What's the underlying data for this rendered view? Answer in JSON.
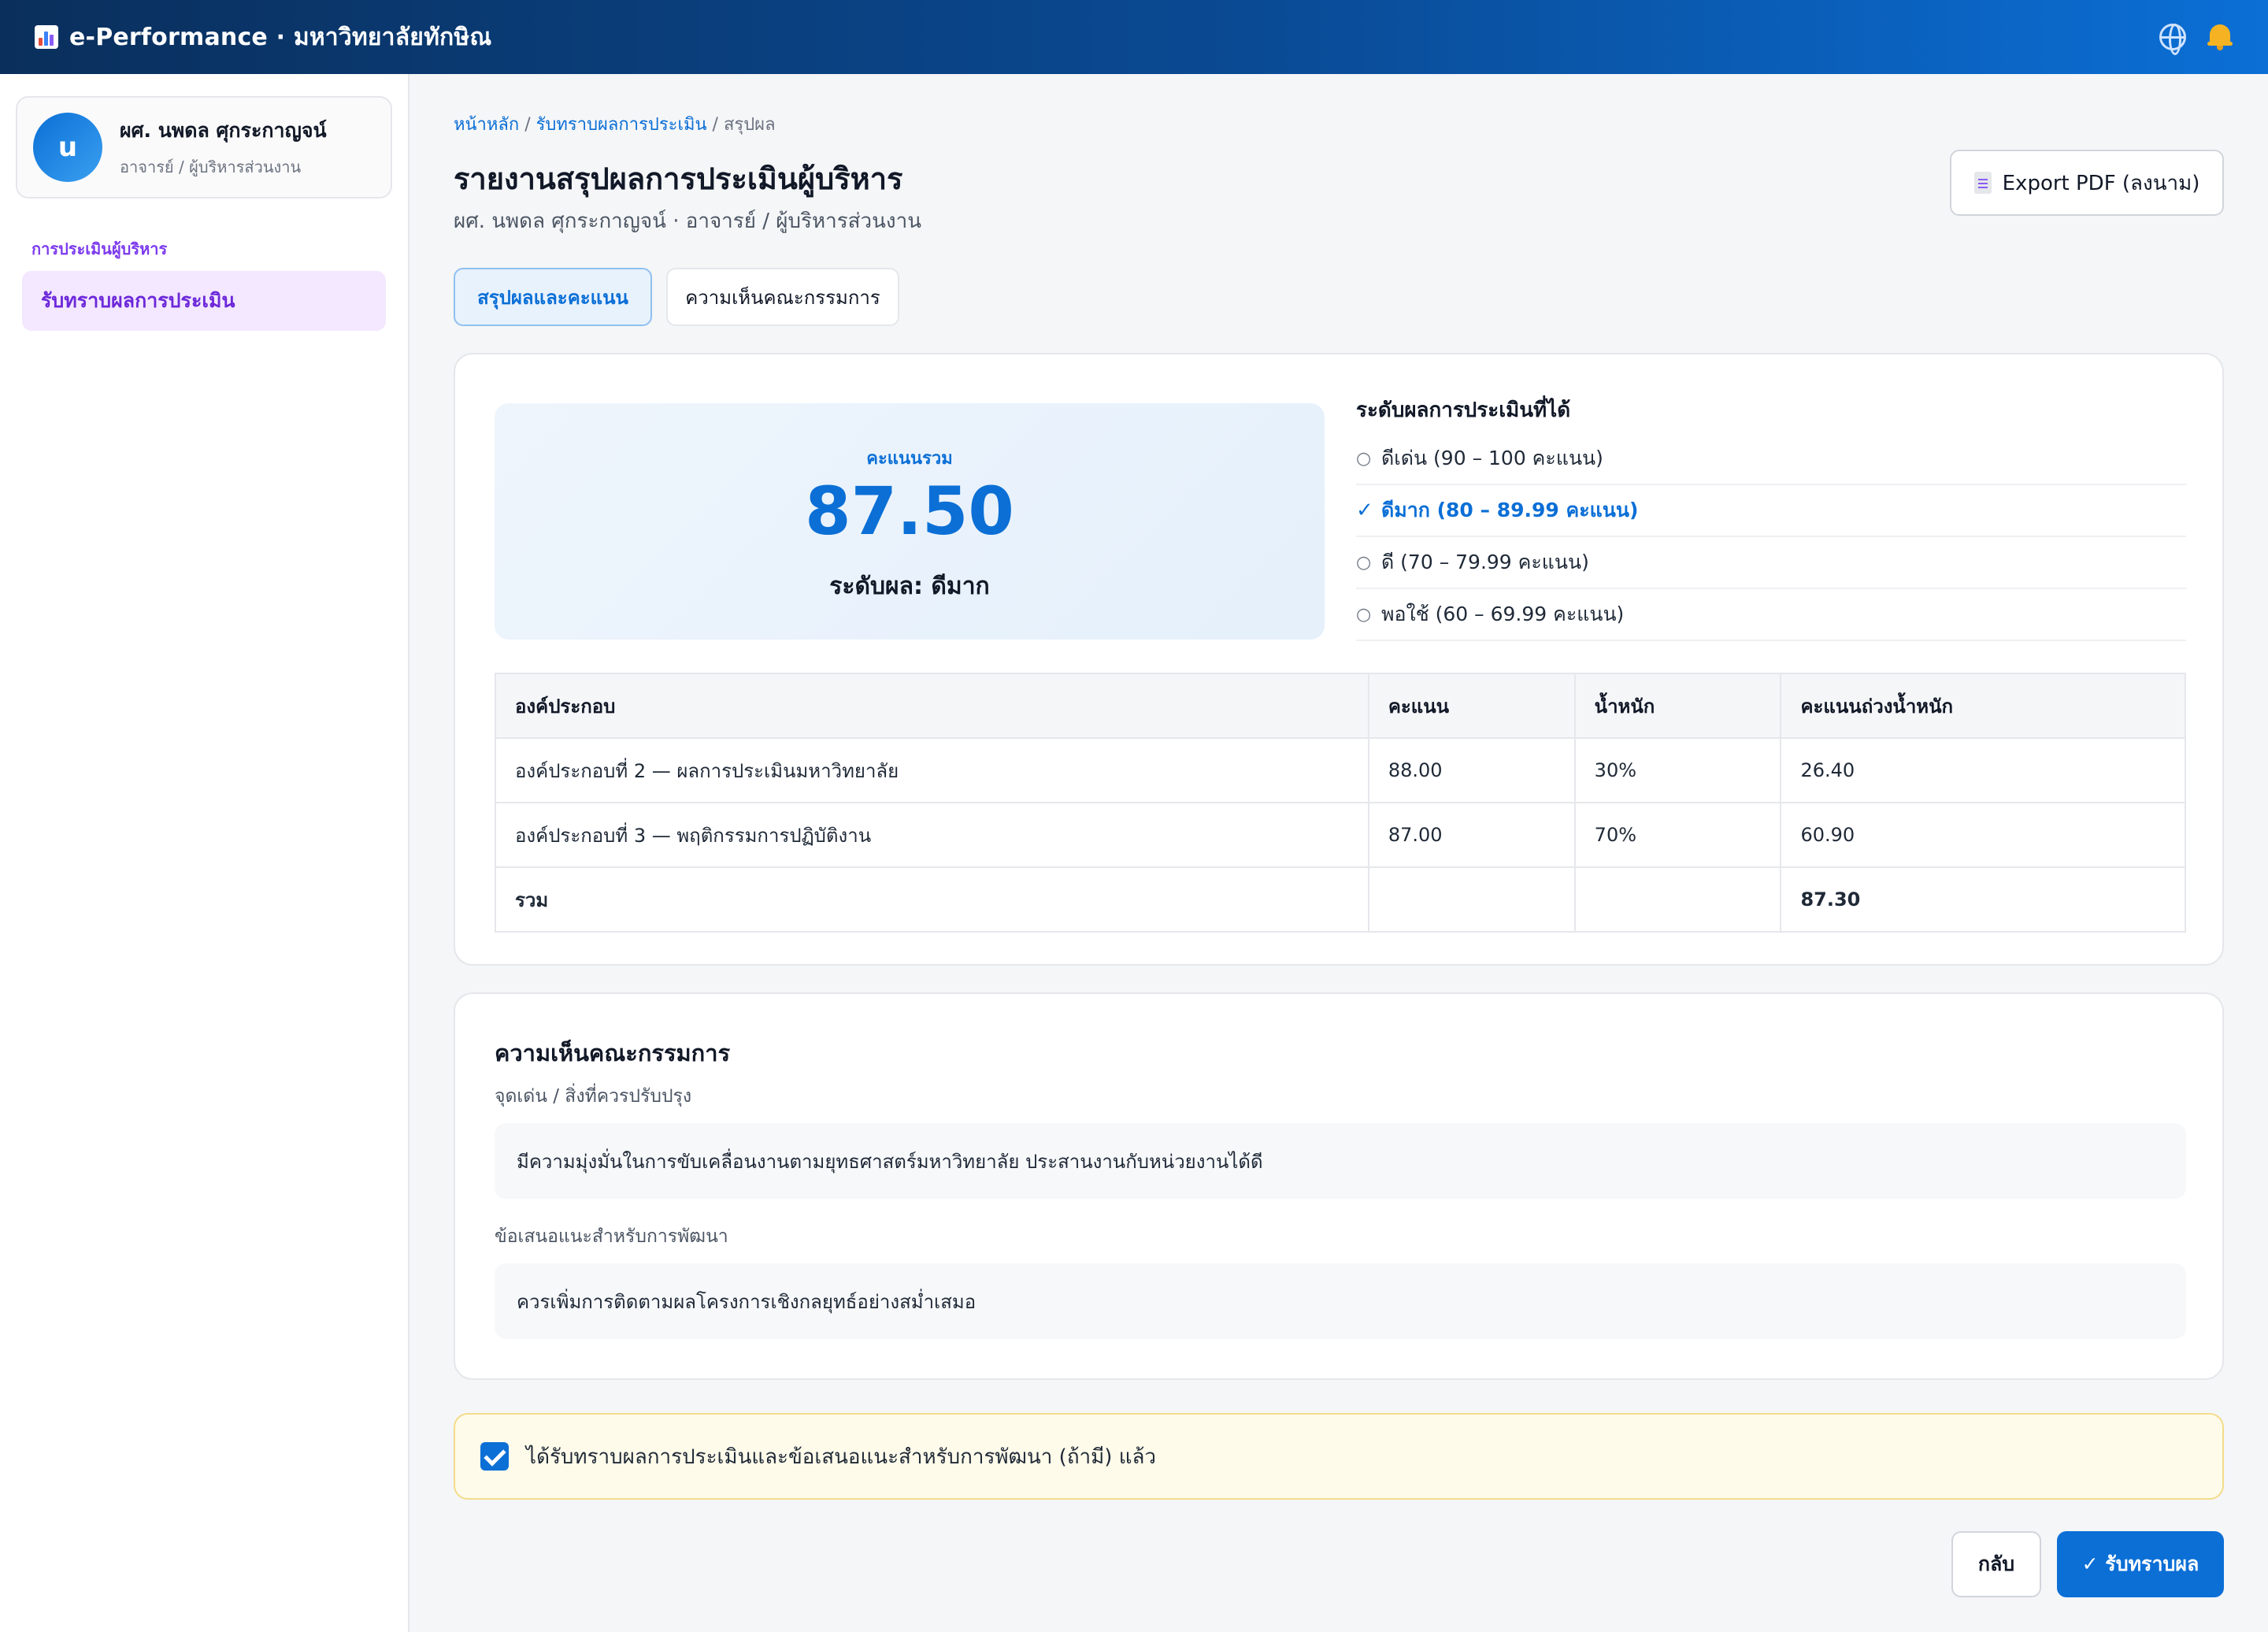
{
  "app": {
    "title": "e-Performance · มหาวิทยาลัยทักษิณ"
  },
  "user": {
    "avatar_letter": "u",
    "name": "ผศ. นพดล ศุกระกาญจน์",
    "role": "อาจารย์ / ผู้บริหารส่วนงาน"
  },
  "sidebar": {
    "section": "การประเมินผู้บริหาร",
    "items": [
      {
        "label": "รับทราบผลการประเมิน"
      }
    ]
  },
  "breadcrumb": {
    "home": "หน้าหลัก",
    "sep": " / ",
    "parent": "รับทราบผลการประเมิน",
    "current": "สรุปผล"
  },
  "header": {
    "title": "รายงานสรุปผลการประเมินผู้บริหาร",
    "subtitle": "ผศ. นพดล ศุกระกาญจน์ · อาจารย์ / ผู้บริหารส่วนงาน",
    "export_label": "Export PDF (ลงนาม)"
  },
  "tabs": [
    {
      "label": "สรุปผลและคะแนน"
    },
    {
      "label": "ความเห็นคณะกรรมการ"
    }
  ],
  "score": {
    "label": "คะแนนรวม",
    "value": "87.50",
    "level_text": "ระดับผล: ดีมาก"
  },
  "levels": {
    "title": "ระดับผลการประเมินที่ได้",
    "items": [
      {
        "mark": "○",
        "label": "ดีเด่น (90 – 100 คะแนน)"
      },
      {
        "mark": "✓",
        "label": "ดีมาก (80 – 89.99 คะแนน)"
      },
      {
        "mark": "○",
        "label": "ดี (70 – 79.99 คะแนน)"
      },
      {
        "mark": "○",
        "label": "พอใช้ (60 – 69.99 คะแนน)"
      }
    ]
  },
  "table": {
    "headers": [
      "องค์ประกอบ",
      "คะแนน",
      "น้ำหนัก",
      "คะแนนถ่วงน้ำหนัก"
    ],
    "rows": [
      [
        "องค์ประกอบที่ 2 — ผลการประเมินมหาวิทยาลัย",
        "88.00",
        "30%",
        "26.40"
      ],
      [
        "องค์ประกอบที่ 3 — พฤติกรรมการปฏิบัติงาน",
        "87.00",
        "70%",
        "60.90"
      ]
    ],
    "total": [
      "รวม",
      "",
      "",
      "87.30"
    ]
  },
  "committee": {
    "title": "ความเห็นคณะกรรมการ",
    "strength_label": "จุดเด่น / สิ่งที่ควรปรับปรุง",
    "strength_text": "มีความมุ่งมั่นในการขับเคลื่อนงานตามยุทธศาสตร์มหาวิทยาลัย ประสานงานกับหน่วยงานได้ดี",
    "suggestion_label": "ข้อเสนอแนะสำหรับการพัฒนา",
    "suggestion_text": "ควรเพิ่มการติดตามผลโครงการเชิงกลยุทธ์อย่างสม่ำเสมอ"
  },
  "ack": {
    "label": "ได้รับทราบผลการประเมินและข้อเสนอแนะสำหรับการพัฒนา (ถ้ามี) แล้ว",
    "checked": true
  },
  "actions": {
    "back": "กลับ",
    "acknowledge": "✓ รับทราบผล"
  },
  "colors": {
    "primary": "#0b6fd6",
    "accent_purple": "#7c3aed",
    "ack_bg": "#fffbea"
  }
}
